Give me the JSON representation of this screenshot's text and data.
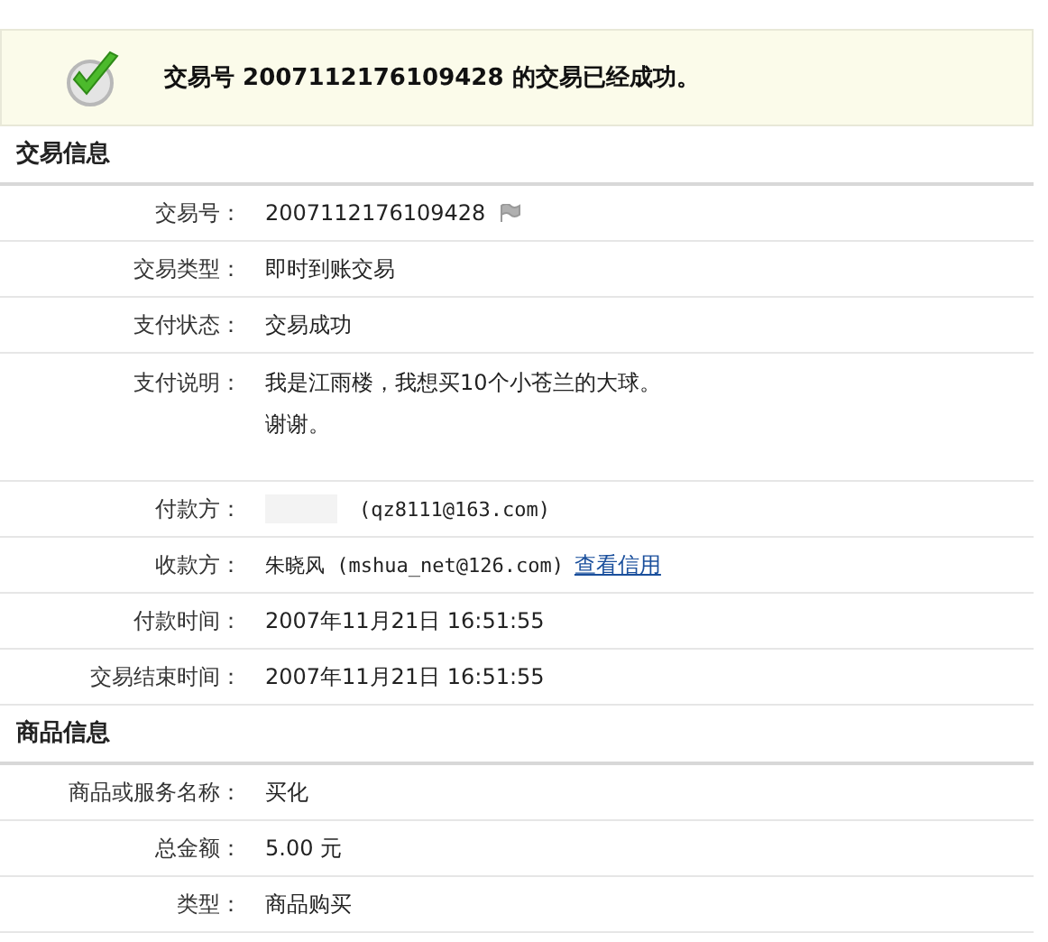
{
  "banner": {
    "text": "交易号 2007112176109428 的交易已经成功。"
  },
  "sections": [
    {
      "title": "交易信息",
      "rows": [
        {
          "label": "交易号：",
          "kind": "flag",
          "value": "2007112176109428"
        },
        {
          "label": "交易类型：",
          "kind": "plain",
          "value": "即时到账交易"
        },
        {
          "label": "支付状态：",
          "kind": "plain",
          "value": "交易成功"
        },
        {
          "label": "支付说明：",
          "kind": "multiline",
          "lines": [
            "我是江雨楼，我想买10个小苍兰的大球。",
            "谢谢。"
          ]
        },
        {
          "label": "付款方：",
          "kind": "redacted",
          "value": "(qz8111@163.com)"
        },
        {
          "label": "收款方：",
          "kind": "link",
          "value": "朱晓风 (mshua_net@126.com)",
          "link": "查看信用"
        },
        {
          "label": "付款时间：",
          "kind": "plain",
          "value": "2007年11月21日 16:51:55"
        },
        {
          "label": "交易结束时间：",
          "kind": "plain",
          "value": "2007年11月21日 16:51:55"
        }
      ]
    },
    {
      "title": "商品信息",
      "rows": [
        {
          "label": "商品或服务名称：",
          "kind": "plain",
          "value": "买化"
        },
        {
          "label": "总金额：",
          "kind": "plain",
          "value": "5.00 元"
        },
        {
          "label": "类型：",
          "kind": "plain",
          "value": "商品购买"
        }
      ]
    }
  ]
}
